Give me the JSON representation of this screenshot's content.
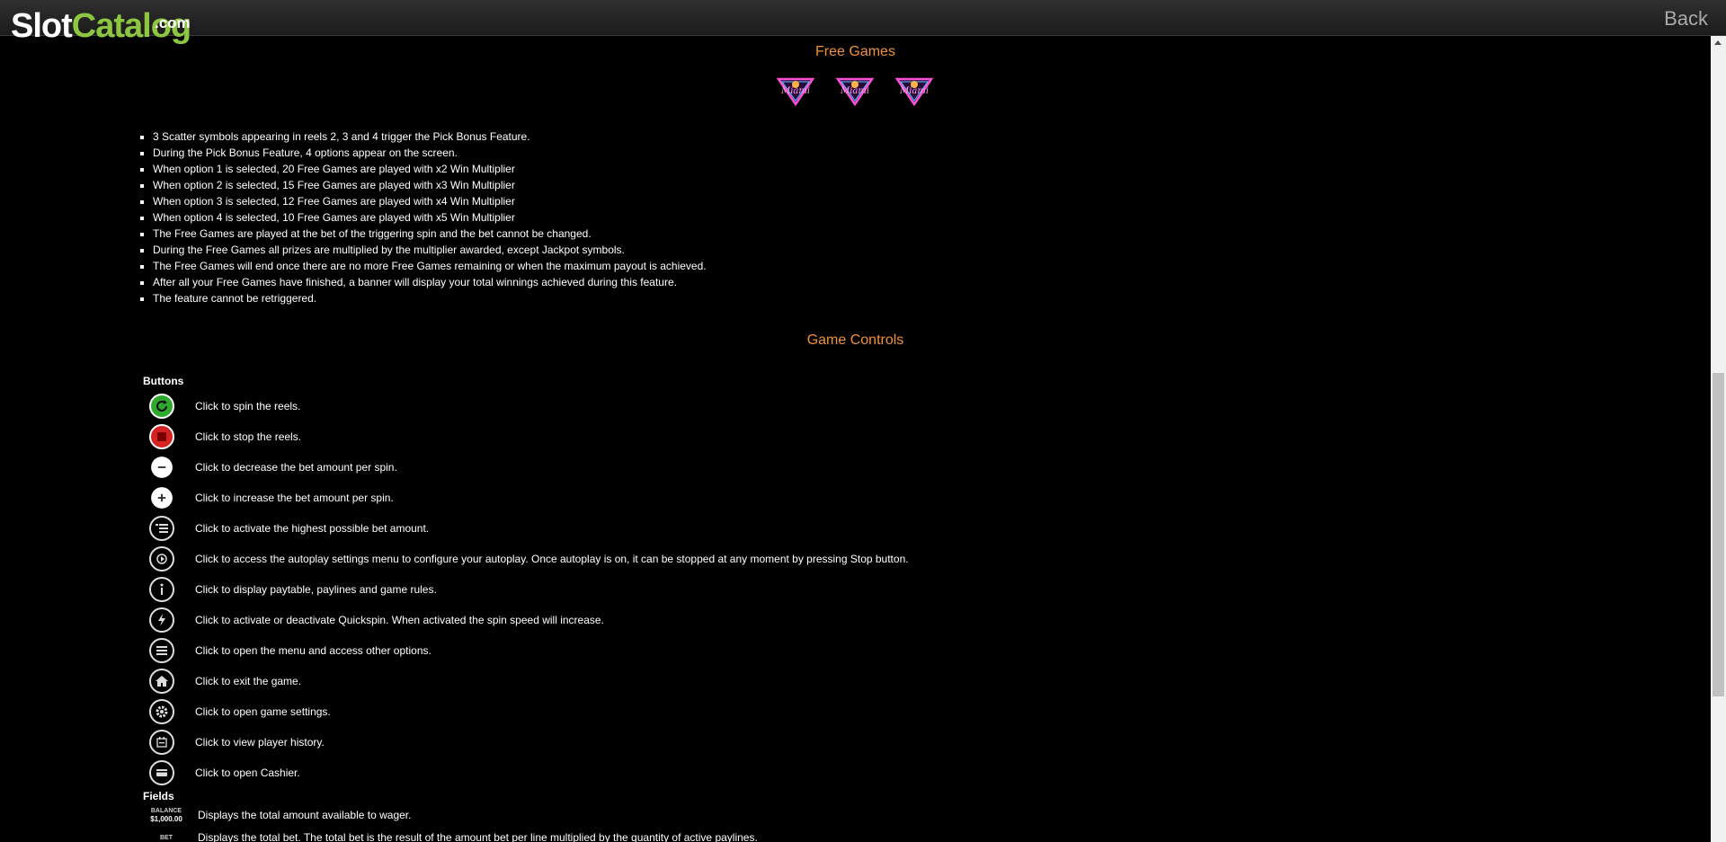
{
  "header": {
    "logo_slot": "Slot",
    "logo_catalog": "Catalog",
    "logo_com": ".com",
    "back_label": "Back"
  },
  "free_games": {
    "title": "Free Games",
    "scatter_icon": "miami-scatter-icon",
    "scatter_count": 3,
    "rules": [
      "3 Scatter symbols appearing in reels 2, 3 and 4 trigger the Pick Bonus Feature.",
      "During the Pick Bonus Feature, 4 options appear on the screen.",
      "When option 1 is selected, 20 Free Games are played with x2 Win Multiplier",
      "When option 2 is selected, 15 Free Games are played with x3 Win Multiplier",
      "When option 3 is selected, 12 Free Games are played with x4 Win Multiplier",
      "When option 4 is selected, 10 Free Games are played with x5 Win Multiplier",
      "The Free Games are played at the bet of the triggering spin and the bet cannot be changed.",
      "During the Free Games all prizes are multiplied by the multiplier awarded, except Jackpot symbols.",
      "The Free Games will end once there are no more Free Games remaining or when the maximum payout is achieved.",
      "After all your Free Games have finished, a banner will display your total winnings achieved during this feature.",
      "The feature cannot be retriggered."
    ]
  },
  "game_controls": {
    "title": "Game Controls",
    "buttons_label": "Buttons",
    "buttons": [
      {
        "icon": "spin-icon",
        "desc": "Click to spin the reels."
      },
      {
        "icon": "stop-icon",
        "desc": "Click to stop the reels."
      },
      {
        "icon": "minus-icon",
        "desc": "Click to decrease the bet amount per spin."
      },
      {
        "icon": "plus-icon",
        "desc": "Click to increase the bet amount per spin."
      },
      {
        "icon": "max-bet-icon",
        "desc": "Click to activate the highest possible bet amount."
      },
      {
        "icon": "autoplay-icon",
        "desc": "Click to access the autoplay settings menu to configure your autoplay. Once autoplay is on, it can be stopped at any moment by pressing Stop button."
      },
      {
        "icon": "info-icon",
        "desc": "Click to display paytable, paylines and game rules."
      },
      {
        "icon": "quickspin-icon",
        "desc": "Click to activate or deactivate Quickspin. When activated the spin speed will increase."
      },
      {
        "icon": "menu-icon",
        "desc": "Click to open the menu and access other options."
      },
      {
        "icon": "home-icon",
        "desc": "Click to exit the game."
      },
      {
        "icon": "settings-icon",
        "desc": "Click to open game settings."
      },
      {
        "icon": "history-icon",
        "desc": "Click to view player history."
      },
      {
        "icon": "cashier-icon",
        "desc": "Click to open Cashier."
      }
    ],
    "fields_label": "Fields",
    "fields": [
      {
        "label": "BALANCE",
        "value": "$1,000.00",
        "desc": "Displays the total amount available to wager."
      },
      {
        "label": "BET",
        "value": "",
        "desc": "Displays the total bet. The total bet is the result of the amount bet per line multiplied by the quantity of active paylines."
      }
    ]
  },
  "colors": {
    "accent_title": "#f0913a",
    "spin_green": "#2fa82f",
    "stop_red": "#d62222",
    "logo_green": "#8dc63f"
  }
}
